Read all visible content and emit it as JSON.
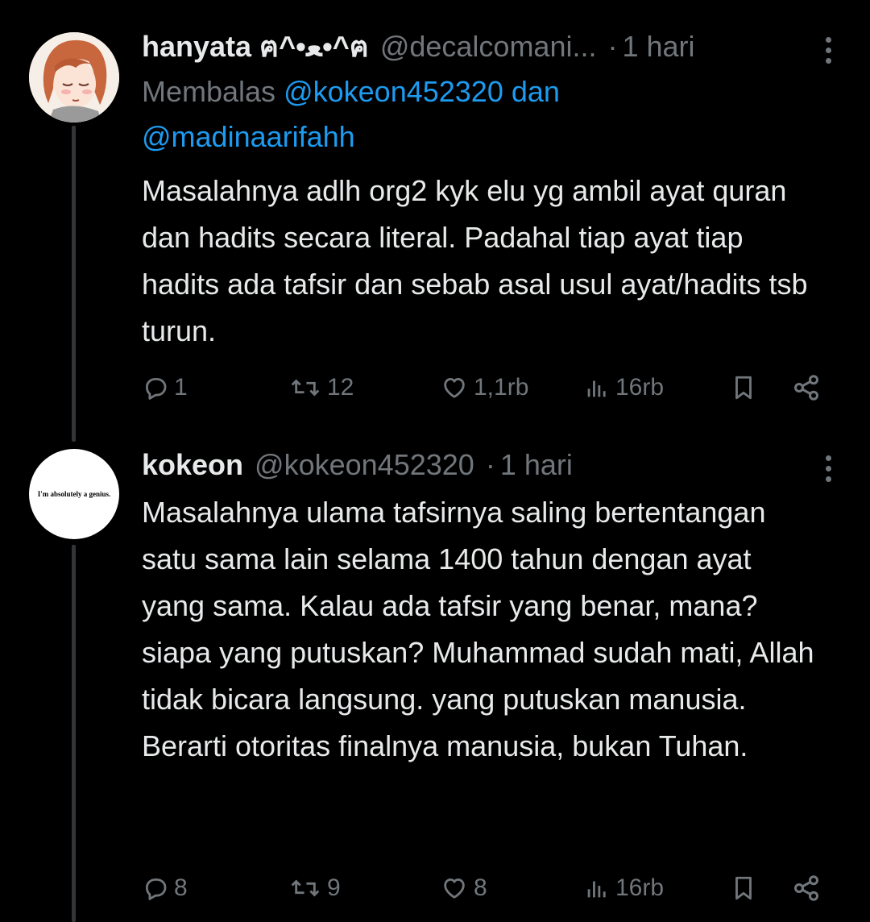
{
  "colors": {
    "background": "#000000",
    "text": "#e7e9ea",
    "muted": "#71767b",
    "link": "#1d9bf0",
    "thread_line": "#333639"
  },
  "tweets": [
    {
      "display_name": "hanyata ฅ^•ﻌ•^ฅ",
      "handle": "@decalcomani...",
      "dot": "·",
      "time": "1 hari",
      "avatar_icon": "anime-avatar-icon",
      "reply_prefix": "Membalas",
      "reply_mention_1": "@kokeon452320",
      "reply_joiner": "dan",
      "reply_mention_2": "@madinaarifahh",
      "text": "Masalahnya adlh org2 kyk elu yg ambil ayat quran dan hadits secara literal. Padahal tiap ayat tiap hadits ada tafsir dan sebab asal usul ayat/hadits tsb turun.",
      "replies": "1",
      "reposts": "12",
      "likes": "1,1rb",
      "views": "16rb"
    },
    {
      "display_name": "kokeon",
      "handle": "@kokeon452320",
      "dot": "·",
      "time": "1 hari",
      "avatar_icon": "text-avatar-icon",
      "avatar_text": "I'm absolutely a genius.",
      "text": "Masalahnya ulama tafsirnya saling bertentangan satu sama lain selama 1400 tahun dengan ayat yang sama. Kalau ada tafsir yang benar, mana? siapa yang putuskan? Muhammad sudah mati, Allah tidak bicara langsung. yang putuskan manusia. Berarti otoritas finalnya manusia, bukan Tuhan.",
      "replies": "8",
      "reposts": "9",
      "likes": "8",
      "views": "16rb"
    }
  ]
}
